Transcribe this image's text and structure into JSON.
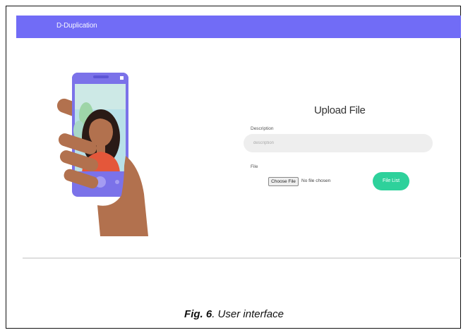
{
  "app": {
    "brand": "D-Duplication"
  },
  "upload": {
    "title": "Upload File",
    "description_label": "Description",
    "description_placeholder": "description",
    "file_label": "File",
    "choose_file_label": "Choose File",
    "no_file_text": "No file chosen",
    "file_list_label": "File List"
  },
  "caption": {
    "fig": "Fig. 6",
    "text": ". User interface"
  },
  "colors": {
    "navbar": "#716cf6",
    "file_list_button": "#2ed19b",
    "hand_skin": "#b2714e",
    "phone_accent": "#7b72e9",
    "shirt": "#e4573a"
  },
  "icons": {
    "illustration": "hand-holding-phone-illustration"
  }
}
